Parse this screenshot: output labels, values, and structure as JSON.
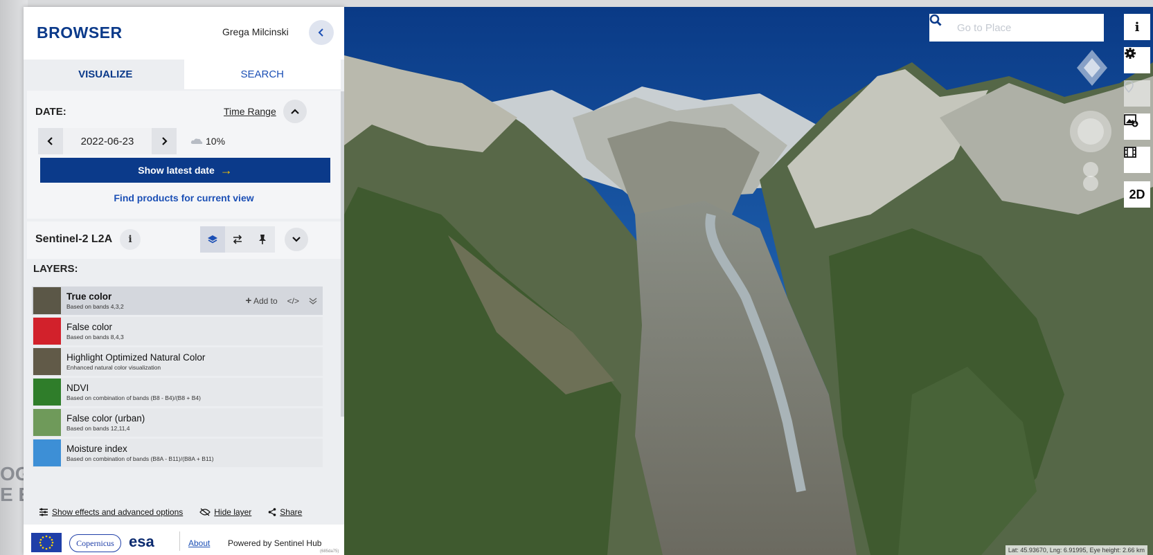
{
  "background": {
    "partial_text_lines": [
      "OG",
      "E E"
    ]
  },
  "header": {
    "brand": "BROWSER",
    "user": "Grega Milcinski"
  },
  "tabs": [
    {
      "label": "VISUALIZE",
      "active": true
    },
    {
      "label": "SEARCH",
      "active": false
    }
  ],
  "date": {
    "label": "DATE:",
    "time_range": "Time Range",
    "value": "2022-06-23",
    "cloud_coverage": "10%",
    "show_latest": "Show latest date",
    "find_products": "Find products for current view"
  },
  "dataset": {
    "name": "Sentinel-2 L2A",
    "info_icon": "i"
  },
  "layers": {
    "title": "LAYERS:",
    "add_to": "Add to",
    "code_label": "</>",
    "items": [
      {
        "title": "True color",
        "subtitle": "Based on bands 4,3,2",
        "selected": true,
        "thumb_color": "#5b5747"
      },
      {
        "title": "False color",
        "subtitle": "Based on bands 8,4,3",
        "selected": false,
        "thumb_color": "#d2212b"
      },
      {
        "title": "Highlight Optimized Natural Color",
        "subtitle": "Enhanced natural color visualization",
        "selected": false,
        "thumb_color": "#615a48"
      },
      {
        "title": "NDVI",
        "subtitle": "Based on combination of bands (B8 - B4)/(B8 + B4)",
        "selected": false,
        "thumb_color": "#2f7d2a"
      },
      {
        "title": "False color (urban)",
        "subtitle": "Based on bands 12,11,4",
        "selected": false,
        "thumb_color": "#6f9a5a"
      },
      {
        "title": "Moisture index",
        "subtitle": "Based on combination of bands (B8A - B11)/(B8A + B11)",
        "selected": false,
        "thumb_color": "#3d8fd6"
      }
    ]
  },
  "options": {
    "show_effects": "Show effects and advanced options",
    "hide_layer": "Hide layer",
    "share": "Share"
  },
  "footer": {
    "copernicus": "Copernicus",
    "esa": "esa",
    "about": "About",
    "powered_by": "Powered by Sentinel Hub",
    "version": "(685da75)"
  },
  "map": {
    "search_placeholder": "Go to Place",
    "buttons": [
      {
        "label": "i",
        "icon": "info-icon"
      },
      {
        "label": "",
        "icon": "gear-icon"
      },
      {
        "label": "",
        "icon": "pin-icon"
      },
      {
        "label": "",
        "icon": "image-download-icon"
      },
      {
        "label": "",
        "icon": "film-icon"
      },
      {
        "label": "2D",
        "icon": ""
      }
    ],
    "coordinates": "Lat: 45.93670, Lng: 6.91995, Eye height: 2.66 km"
  },
  "colors": {
    "brand": "#0b3a8a",
    "link": "#1b4fb5",
    "accent_arrow": "#f5c400"
  }
}
